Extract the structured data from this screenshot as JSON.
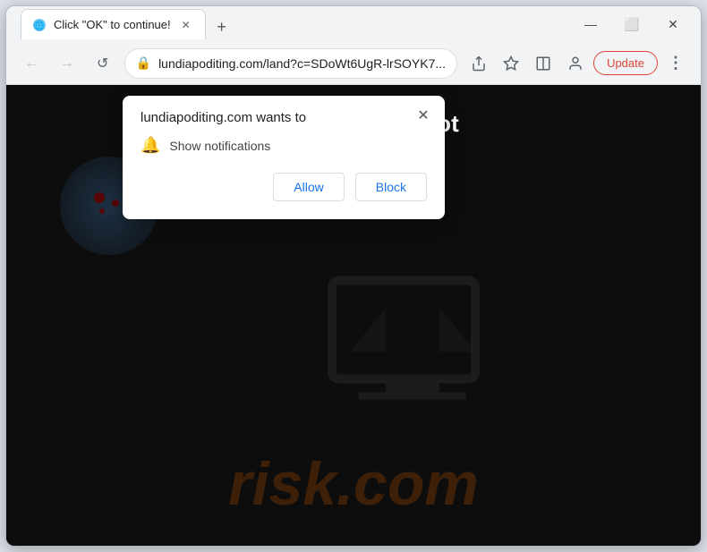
{
  "browser": {
    "title_bar": {
      "tab_label": "Click \"OK\" to continue!",
      "tab_favicon": "🔵",
      "new_tab_icon": "+",
      "minimize_icon": "—",
      "maximize_icon": "⬜",
      "close_icon": "✕"
    },
    "toolbar": {
      "back_icon": "←",
      "forward_icon": "→",
      "reload_icon": "↺",
      "address": "lundiapoditing.com/land?c=SDoWt6UgR-lrSOYK7...",
      "lock_icon": "🔒",
      "share_icon": "⬆",
      "bookmark_icon": "☆",
      "split_icon": "⬜",
      "profile_icon": "👤",
      "update_label": "Update",
      "menu_icon": "⋮"
    },
    "website": {
      "heading": "Click \"OK\" to continue – verify you are not a robot",
      "heading_partial": "you are not a robot",
      "risk_watermark": "risk.com"
    },
    "notification_popup": {
      "title": "lundiapoditing.com wants to",
      "permission_label": "Show notifications",
      "bell_icon": "🔔",
      "close_icon": "✕",
      "allow_label": "Allow",
      "block_label": "Block"
    }
  }
}
